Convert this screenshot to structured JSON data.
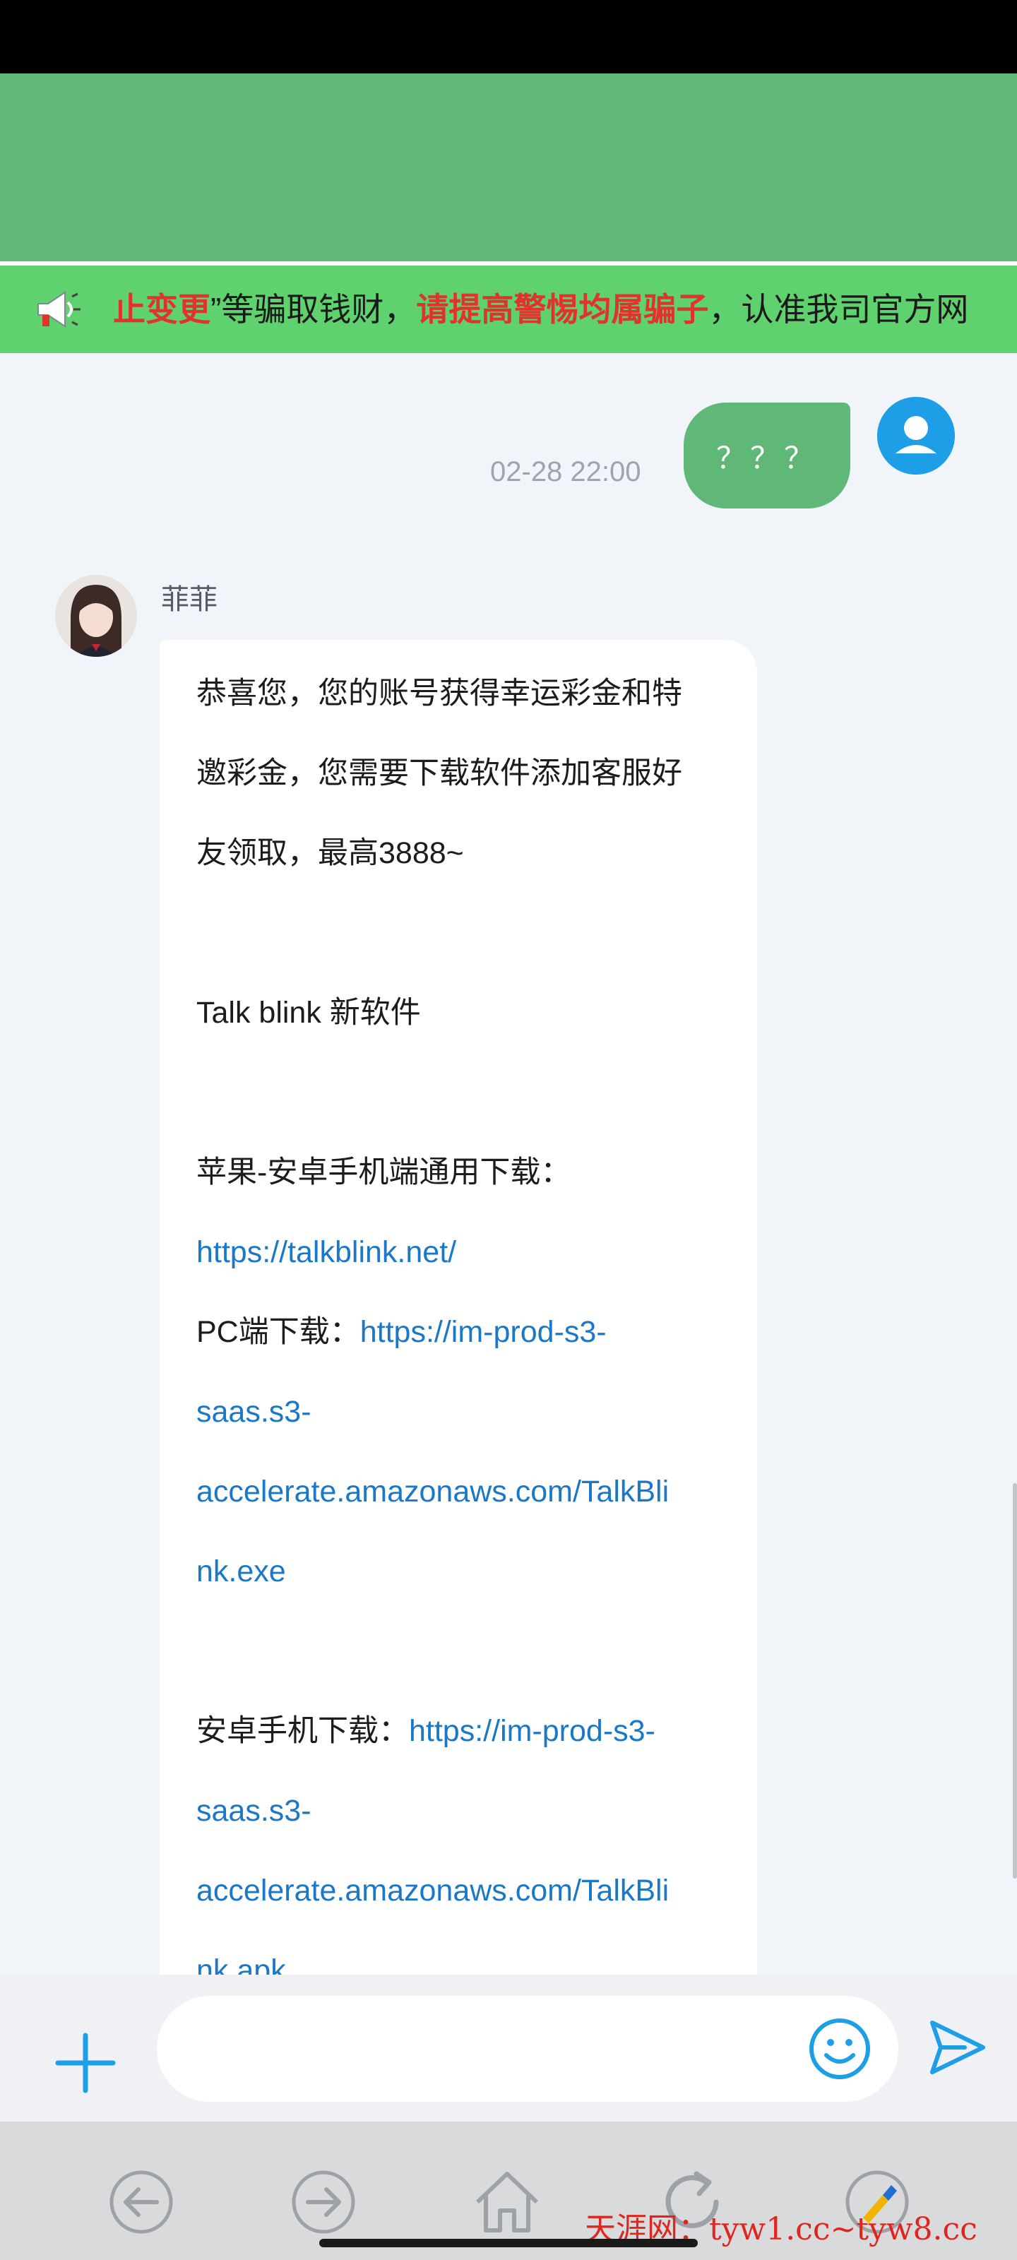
{
  "notice": {
    "seg1_red": "止变更",
    "seg2": "”等骗取钱财，",
    "seg3_red": "请提高警惕均属骗子",
    "seg4": "，认准我司官方网"
  },
  "chat": {
    "sent": {
      "text": "？？？",
      "time": "02-28 22:00"
    },
    "agent_name": "菲菲",
    "received_lines": [
      {
        "text": "恭喜您，您的账号获得幸运彩金和特"
      },
      {
        "text": "邀彩金，您需要下载软件添加客服好"
      },
      {
        "text": "友领取，最高3888~"
      },
      {
        "text": ""
      },
      {
        "text": "Talk blink 新软件"
      },
      {
        "text": ""
      },
      {
        "text": "苹果-安卓手机端通用下载："
      },
      {
        "link": "https://talkblink.net/"
      },
      {
        "text": "PC端下载：",
        "link": "https://im-prod-s3-"
      },
      {
        "link": "saas.s3-"
      },
      {
        "link": "accelerate.amazonaws.com/TalkBli"
      },
      {
        "link": "nk.exe"
      },
      {
        "text": ""
      },
      {
        "text": "安卓手机下载：",
        "link": "https://im-prod-s3-"
      },
      {
        "link": "saas.s3-"
      },
      {
        "link": "accelerate.amazonaws.com/TalkBli"
      },
      {
        "link": "nk.apk"
      }
    ]
  },
  "input": {
    "placeholder": ""
  },
  "watermark": "天涯网：tyw1.cc~tyw8.cc",
  "colors": {
    "header_green": "#5fb878",
    "notice_green": "#5fd16e",
    "notice_red": "#e0332b",
    "link_blue": "#1b78c8",
    "accent_blue": "#1e9ee6"
  },
  "icons": {
    "notice": "megaphone-icon",
    "self_avatar": "user-icon",
    "plus": "plus-icon",
    "emoji": "smiley-icon",
    "send": "send-arrow-icon",
    "nav": [
      "back-arrow-icon",
      "forward-arrow-icon",
      "home-icon",
      "refresh-icon",
      "clean-brush-icon"
    ]
  }
}
